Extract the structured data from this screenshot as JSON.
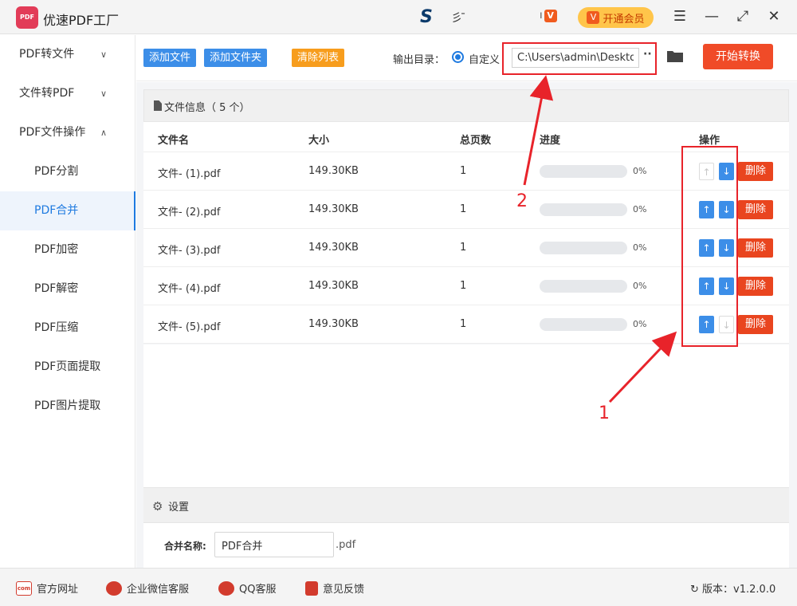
{
  "window": {
    "logo_text": "PDF",
    "title": "优速PDF工厂",
    "user_letter": "S",
    "user_name": "彡 ̄",
    "vip_button": "开通会员",
    "vip_icon_letter": "V",
    "min_glyph": "—",
    "max_glyph": "⤢",
    "close_glyph": "✕",
    "menu_glyph": "☰"
  },
  "sidebar": {
    "groups": [
      {
        "label": "PDF转文件",
        "chevron": "∨"
      },
      {
        "label": "文件转PDF",
        "chevron": "∨"
      },
      {
        "label": "PDF文件操作",
        "chevron": "∧"
      }
    ],
    "sub_items": [
      {
        "label": "PDF分割"
      },
      {
        "label": "PDF合并",
        "active": true
      },
      {
        "label": "PDF加密"
      },
      {
        "label": "PDF解密"
      },
      {
        "label": "PDF压缩"
      },
      {
        "label": "PDF页面提取"
      },
      {
        "label": "PDF图片提取"
      }
    ]
  },
  "toolbar": {
    "add_file": "添加文件",
    "add_folder": "添加文件夹",
    "clear_list": "清除列表",
    "output_label": "输出目录：",
    "custom_label": "自定义",
    "output_path": "C:\\Users\\admin\\Deskto",
    "more": "··",
    "start": "开始转换"
  },
  "file_list": {
    "header": "文件信息（ 5 个）",
    "columns": [
      "文件名",
      "大小",
      "总页数",
      "进度",
      "操作"
    ],
    "rows": [
      {
        "name": "文件- (1).pdf",
        "size": "149.30KB",
        "pages": "1",
        "progress": 0,
        "progress_text": "0%",
        "up_enabled": false,
        "down_enabled": true
      },
      {
        "name": "文件- (2).pdf",
        "size": "149.30KB",
        "pages": "1",
        "progress": 0,
        "progress_text": "0%",
        "up_enabled": true,
        "down_enabled": true
      },
      {
        "name": "文件- (3).pdf",
        "size": "149.30KB",
        "pages": "1",
        "progress": 0,
        "progress_text": "0%",
        "up_enabled": true,
        "down_enabled": true
      },
      {
        "name": "文件- (4).pdf",
        "size": "149.30KB",
        "pages": "1",
        "progress": 0,
        "progress_text": "0%",
        "up_enabled": true,
        "down_enabled": true
      },
      {
        "name": "文件- (5).pdf",
        "size": "149.30KB",
        "pages": "1",
        "progress": 0,
        "progress_text": "0%",
        "up_enabled": true,
        "down_enabled": false
      }
    ],
    "delete_label": "删除",
    "up_glyph": "↑",
    "down_glyph": "↓"
  },
  "settings": {
    "title": "设置",
    "merge_label": "合并名称:",
    "merge_value": "PDF合并",
    "merge_ext": ".pdf",
    "gear_glyph": "⚙"
  },
  "footer": {
    "website": "官方网址",
    "wechat": "企业微信客服",
    "qq": "QQ客服",
    "feedback": "意见反馈",
    "version": "版本：v1.2.0.0",
    "website_icon_text": "com",
    "refresh_glyph": "↻"
  },
  "annotations": {
    "label_1": "1",
    "label_2": "2",
    "color": "#e8232a"
  },
  "colors": {
    "accent_blue": "#3c8ee8",
    "orange": "#f79d1d",
    "start_red": "#f04b28",
    "delete_red": "#e9451f",
    "vip_yellow": "#ffc54a"
  }
}
